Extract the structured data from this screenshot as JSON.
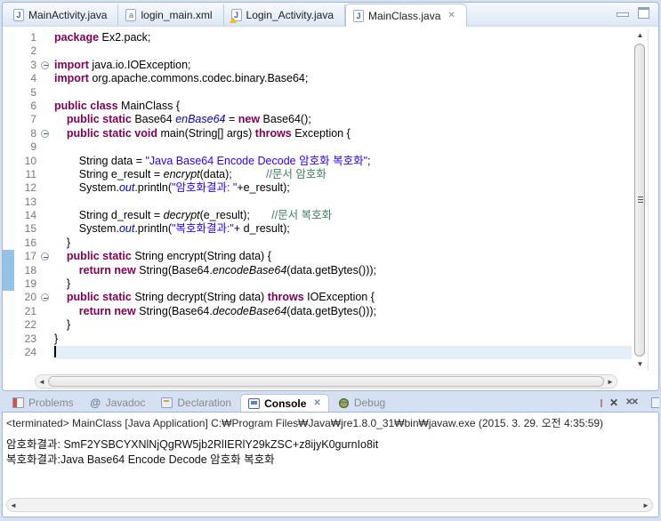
{
  "colors": {
    "keyword": "#7f0055",
    "string": "#2a00ff",
    "comment": "#3f7f5f",
    "static_field": "#0000c0",
    "current_line_bg": "#e4effa",
    "selection_bar": "#92c2e4",
    "window_bg": "#d5e1f2"
  },
  "icons": {
    "tab_close_glyph": "✕",
    "scroll_up_glyph": "▲",
    "scroll_down_glyph": "▼",
    "scroll_left_glyph": "◄",
    "scroll_right_glyph": "►",
    "javadoc_glyph": "@",
    "remove_glyph": "✕",
    "remove_all_glyph": "✕✕"
  },
  "editor_tabs": [
    {
      "label": "MainActivity.java",
      "icon": "java-file",
      "glyph": "J",
      "active": false,
      "closable": false
    },
    {
      "label": "login_main.xml",
      "icon": "xml-file",
      "glyph": "a",
      "active": false,
      "closable": false
    },
    {
      "label": "Login_Activity.java",
      "icon": "java-file-warning",
      "glyph": "J",
      "active": false,
      "closable": false
    },
    {
      "label": "MainClass.java",
      "icon": "java-file",
      "glyph": "J",
      "active": true,
      "closable": true
    }
  ],
  "editor": {
    "current_line": 24,
    "selection_bar_lines": [
      17,
      18,
      19
    ],
    "folded_lines": [
      3,
      8,
      17,
      20
    ],
    "lines": [
      {
        "n": 1,
        "seg": [
          [
            "k",
            "package"
          ],
          [
            "p",
            " Ex2.pack;"
          ]
        ]
      },
      {
        "n": 2,
        "seg": []
      },
      {
        "n": 3,
        "fold": true,
        "seg": [
          [
            "k",
            "import"
          ],
          [
            "p",
            " java.io.IOException;"
          ]
        ]
      },
      {
        "n": 4,
        "seg": [
          [
            "k",
            "import"
          ],
          [
            "p",
            " org.apache.commons.codec.binary.Base64;"
          ]
        ]
      },
      {
        "n": 5,
        "seg": []
      },
      {
        "n": 6,
        "seg": [
          [
            "k",
            "public class"
          ],
          [
            "p",
            " MainClass {"
          ]
        ]
      },
      {
        "n": 7,
        "seg": [
          [
            "p",
            "    "
          ],
          [
            "k",
            "public static"
          ],
          [
            "p",
            " Base64 "
          ],
          [
            "f",
            "enBase64"
          ],
          [
            "p",
            " = "
          ],
          [
            "k",
            "new"
          ],
          [
            "p",
            " Base64();"
          ]
        ]
      },
      {
        "n": 8,
        "fold": true,
        "seg": [
          [
            "p",
            "    "
          ],
          [
            "k",
            "public static void"
          ],
          [
            "p",
            " main(String[] args) "
          ],
          [
            "k",
            "throws"
          ],
          [
            "p",
            " Exception {"
          ]
        ]
      },
      {
        "n": 9,
        "seg": []
      },
      {
        "n": 10,
        "seg": [
          [
            "p",
            "        String data = "
          ],
          [
            "s",
            "\"Java Base64 Encode Decode 암호화 복호화\""
          ],
          [
            "p",
            ";"
          ]
        ]
      },
      {
        "n": 11,
        "seg": [
          [
            "p",
            "        String e_result = "
          ],
          [
            "m",
            "encrypt"
          ],
          [
            "p",
            "(data);           "
          ],
          [
            "c",
            "//문서 암호화"
          ]
        ]
      },
      {
        "n": 12,
        "seg": [
          [
            "p",
            "        System."
          ],
          [
            "f",
            "out"
          ],
          [
            "p",
            ".println("
          ],
          [
            "s",
            "\"암호화결과: \""
          ],
          [
            "p",
            "+e_result);"
          ]
        ]
      },
      {
        "n": 13,
        "seg": []
      },
      {
        "n": 14,
        "seg": [
          [
            "p",
            "        String d_result = "
          ],
          [
            "m",
            "decrypt"
          ],
          [
            "p",
            "(e_result);       "
          ],
          [
            "c",
            "//문서 복호화"
          ]
        ]
      },
      {
        "n": 15,
        "seg": [
          [
            "p",
            "        System."
          ],
          [
            "f",
            "out"
          ],
          [
            "p",
            ".println("
          ],
          [
            "s",
            "\"복호화결과:\""
          ],
          [
            "p",
            "+ d_result);"
          ]
        ]
      },
      {
        "n": 16,
        "seg": [
          [
            "p",
            "    }"
          ]
        ]
      },
      {
        "n": 17,
        "fold": true,
        "sel": true,
        "seg": [
          [
            "p",
            "    "
          ],
          [
            "k",
            "public static"
          ],
          [
            "p",
            " String encrypt(String data) {"
          ]
        ]
      },
      {
        "n": 18,
        "sel": true,
        "seg": [
          [
            "p",
            "        "
          ],
          [
            "k",
            "return new"
          ],
          [
            "p",
            " String(Base64."
          ],
          [
            "m",
            "encodeBase64"
          ],
          [
            "p",
            "(data.getBytes()));"
          ]
        ]
      },
      {
        "n": 19,
        "sel": true,
        "seg": [
          [
            "p",
            "    }"
          ]
        ]
      },
      {
        "n": 20,
        "fold": true,
        "seg": [
          [
            "p",
            "    "
          ],
          [
            "k",
            "public static"
          ],
          [
            "p",
            " String decrypt(String data) "
          ],
          [
            "k",
            "throws"
          ],
          [
            "p",
            " IOException {"
          ]
        ]
      },
      {
        "n": 21,
        "seg": [
          [
            "p",
            "        "
          ],
          [
            "k",
            "return new"
          ],
          [
            "p",
            " String(Base64."
          ],
          [
            "m",
            "decodeBase64"
          ],
          [
            "p",
            "(data.getBytes()));"
          ]
        ]
      },
      {
        "n": 22,
        "seg": [
          [
            "p",
            "    }"
          ]
        ]
      },
      {
        "n": 23,
        "seg": [
          [
            "p",
            "}"
          ]
        ]
      },
      {
        "n": 24,
        "cur": true,
        "seg": []
      }
    ]
  },
  "console": {
    "tabs": [
      {
        "label": "Problems",
        "icon": "problems",
        "active": false,
        "closable": false
      },
      {
        "label": "Javadoc",
        "icon": "javadoc",
        "active": false,
        "closable": false
      },
      {
        "label": "Declaration",
        "icon": "declaration",
        "active": false,
        "closable": false
      },
      {
        "label": "Console",
        "icon": "console",
        "active": true,
        "closable": true
      },
      {
        "label": "Debug",
        "icon": "debug",
        "active": false,
        "closable": false
      }
    ],
    "header": "<terminated> MainClass [Java Application] C:₩Program Files₩Java₩jre1.8.0_31₩bin₩javaw.exe (2015. 3. 29. 오전 4:35:59)",
    "output": [
      "암호화결과: SmF2YSBCYXNlNjQgRW5jb2RlIERlY29kZSC+z8ijyK0gurnIo8it",
      "복호화결과:Java Base64 Encode Decode 암호화 복호화"
    ]
  }
}
